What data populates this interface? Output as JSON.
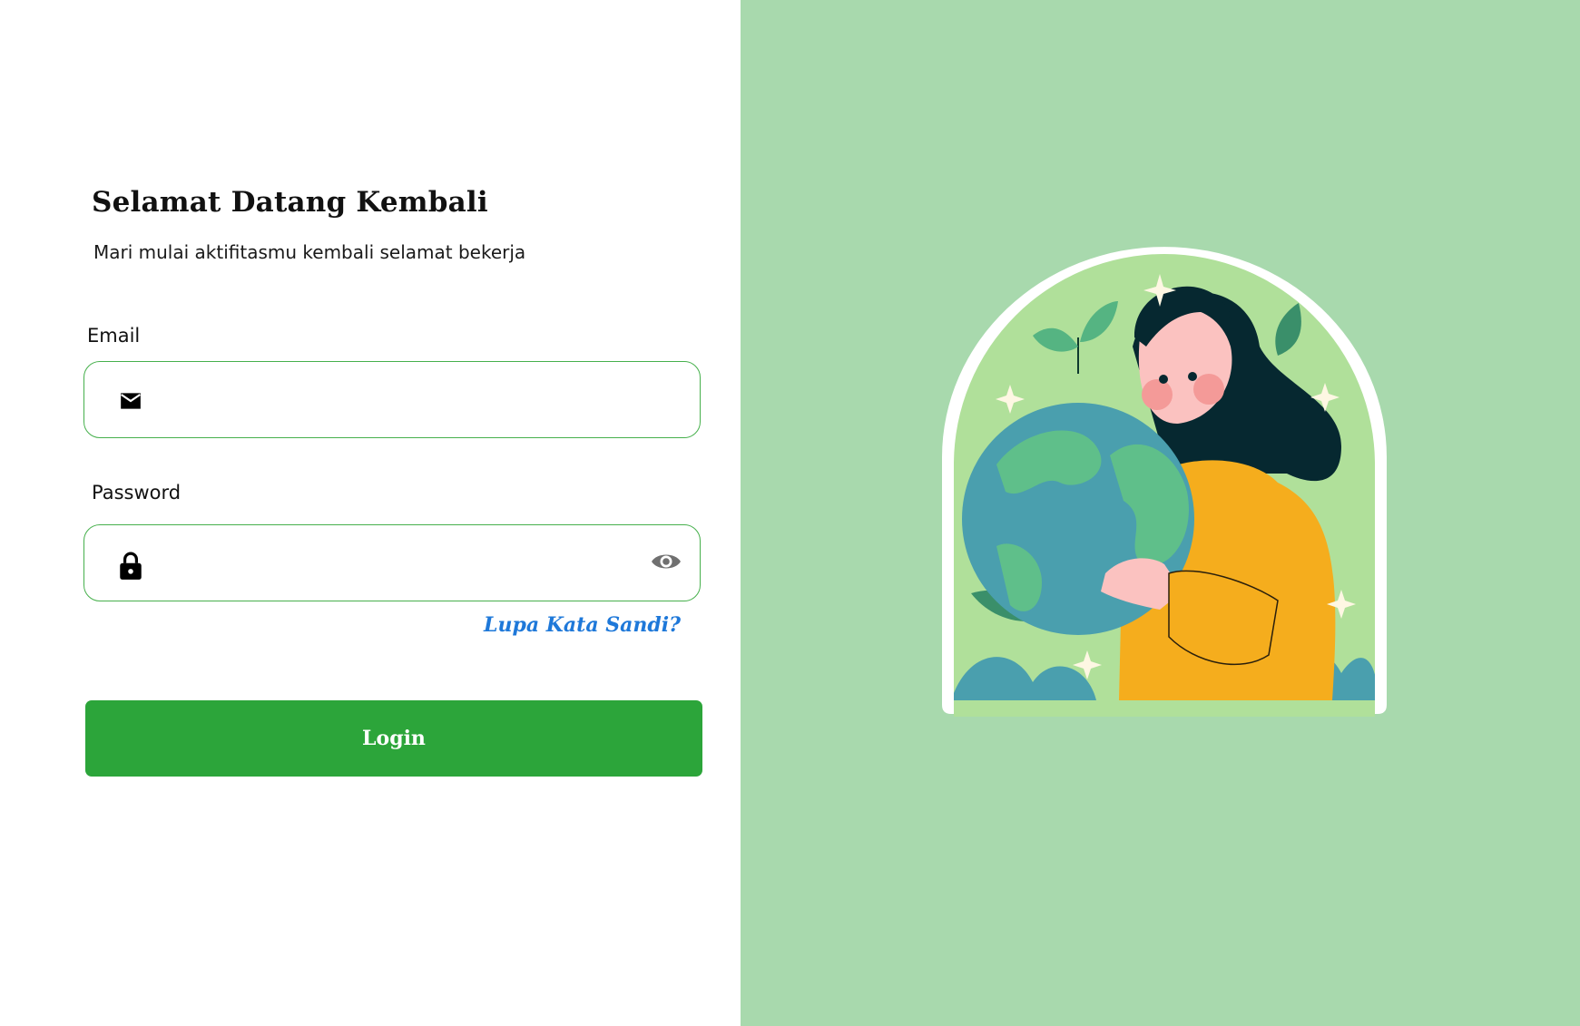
{
  "login": {
    "title": "Selamat Datang Kembali",
    "subtitle": "Mari mulai aktifitasmu kembali selamat bekerja",
    "email_label": "Email",
    "email_value": "",
    "password_label": "Password",
    "password_value": "",
    "forgot_link": "Lupa Kata Sandi?",
    "login_button": "Login"
  },
  "icons": {
    "email_field": "mail-icon",
    "password_field": "lock-icon",
    "password_toggle": "eye-icon"
  },
  "colors": {
    "accent": "#2ca53a",
    "field_border": "#46b04c",
    "link": "#1e78d9",
    "right_panel_bg": "#a8d9ad"
  }
}
